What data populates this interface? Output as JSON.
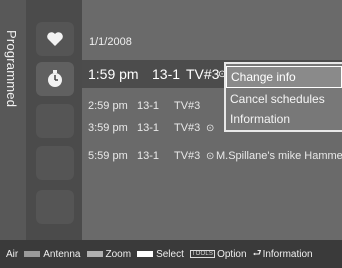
{
  "sidebar": {
    "title": "Programmed"
  },
  "date": "1/1/2008",
  "icons": [
    "favorite-icon",
    "timer-icon"
  ],
  "schedule": [
    {
      "time": "1:59 pm",
      "channel": "13-1",
      "source": "TV#3",
      "program": ""
    },
    {
      "time": "2:59 pm",
      "channel": "13-1",
      "source": "TV#3",
      "program": ""
    },
    {
      "time": "3:59 pm",
      "channel": "13-1",
      "source": "TV#3",
      "program": ""
    },
    {
      "time": "5:59 pm",
      "channel": "13-1",
      "source": "TV#3",
      "program": "M.Spillane's mike Hammer"
    }
  ],
  "popup": {
    "items": [
      "Change info",
      "Cancel schedules",
      "Information"
    ]
  },
  "footer": {
    "air": "Air",
    "antenna": "Antenna",
    "zoom": "Zoom",
    "select": "Select",
    "tools_key": "TOOLS",
    "option": "Option",
    "information": "Information",
    "colors": {
      "antenna": "#9a9a9a",
      "zoom": "#b0b0b0",
      "select": "#ffffff"
    }
  }
}
